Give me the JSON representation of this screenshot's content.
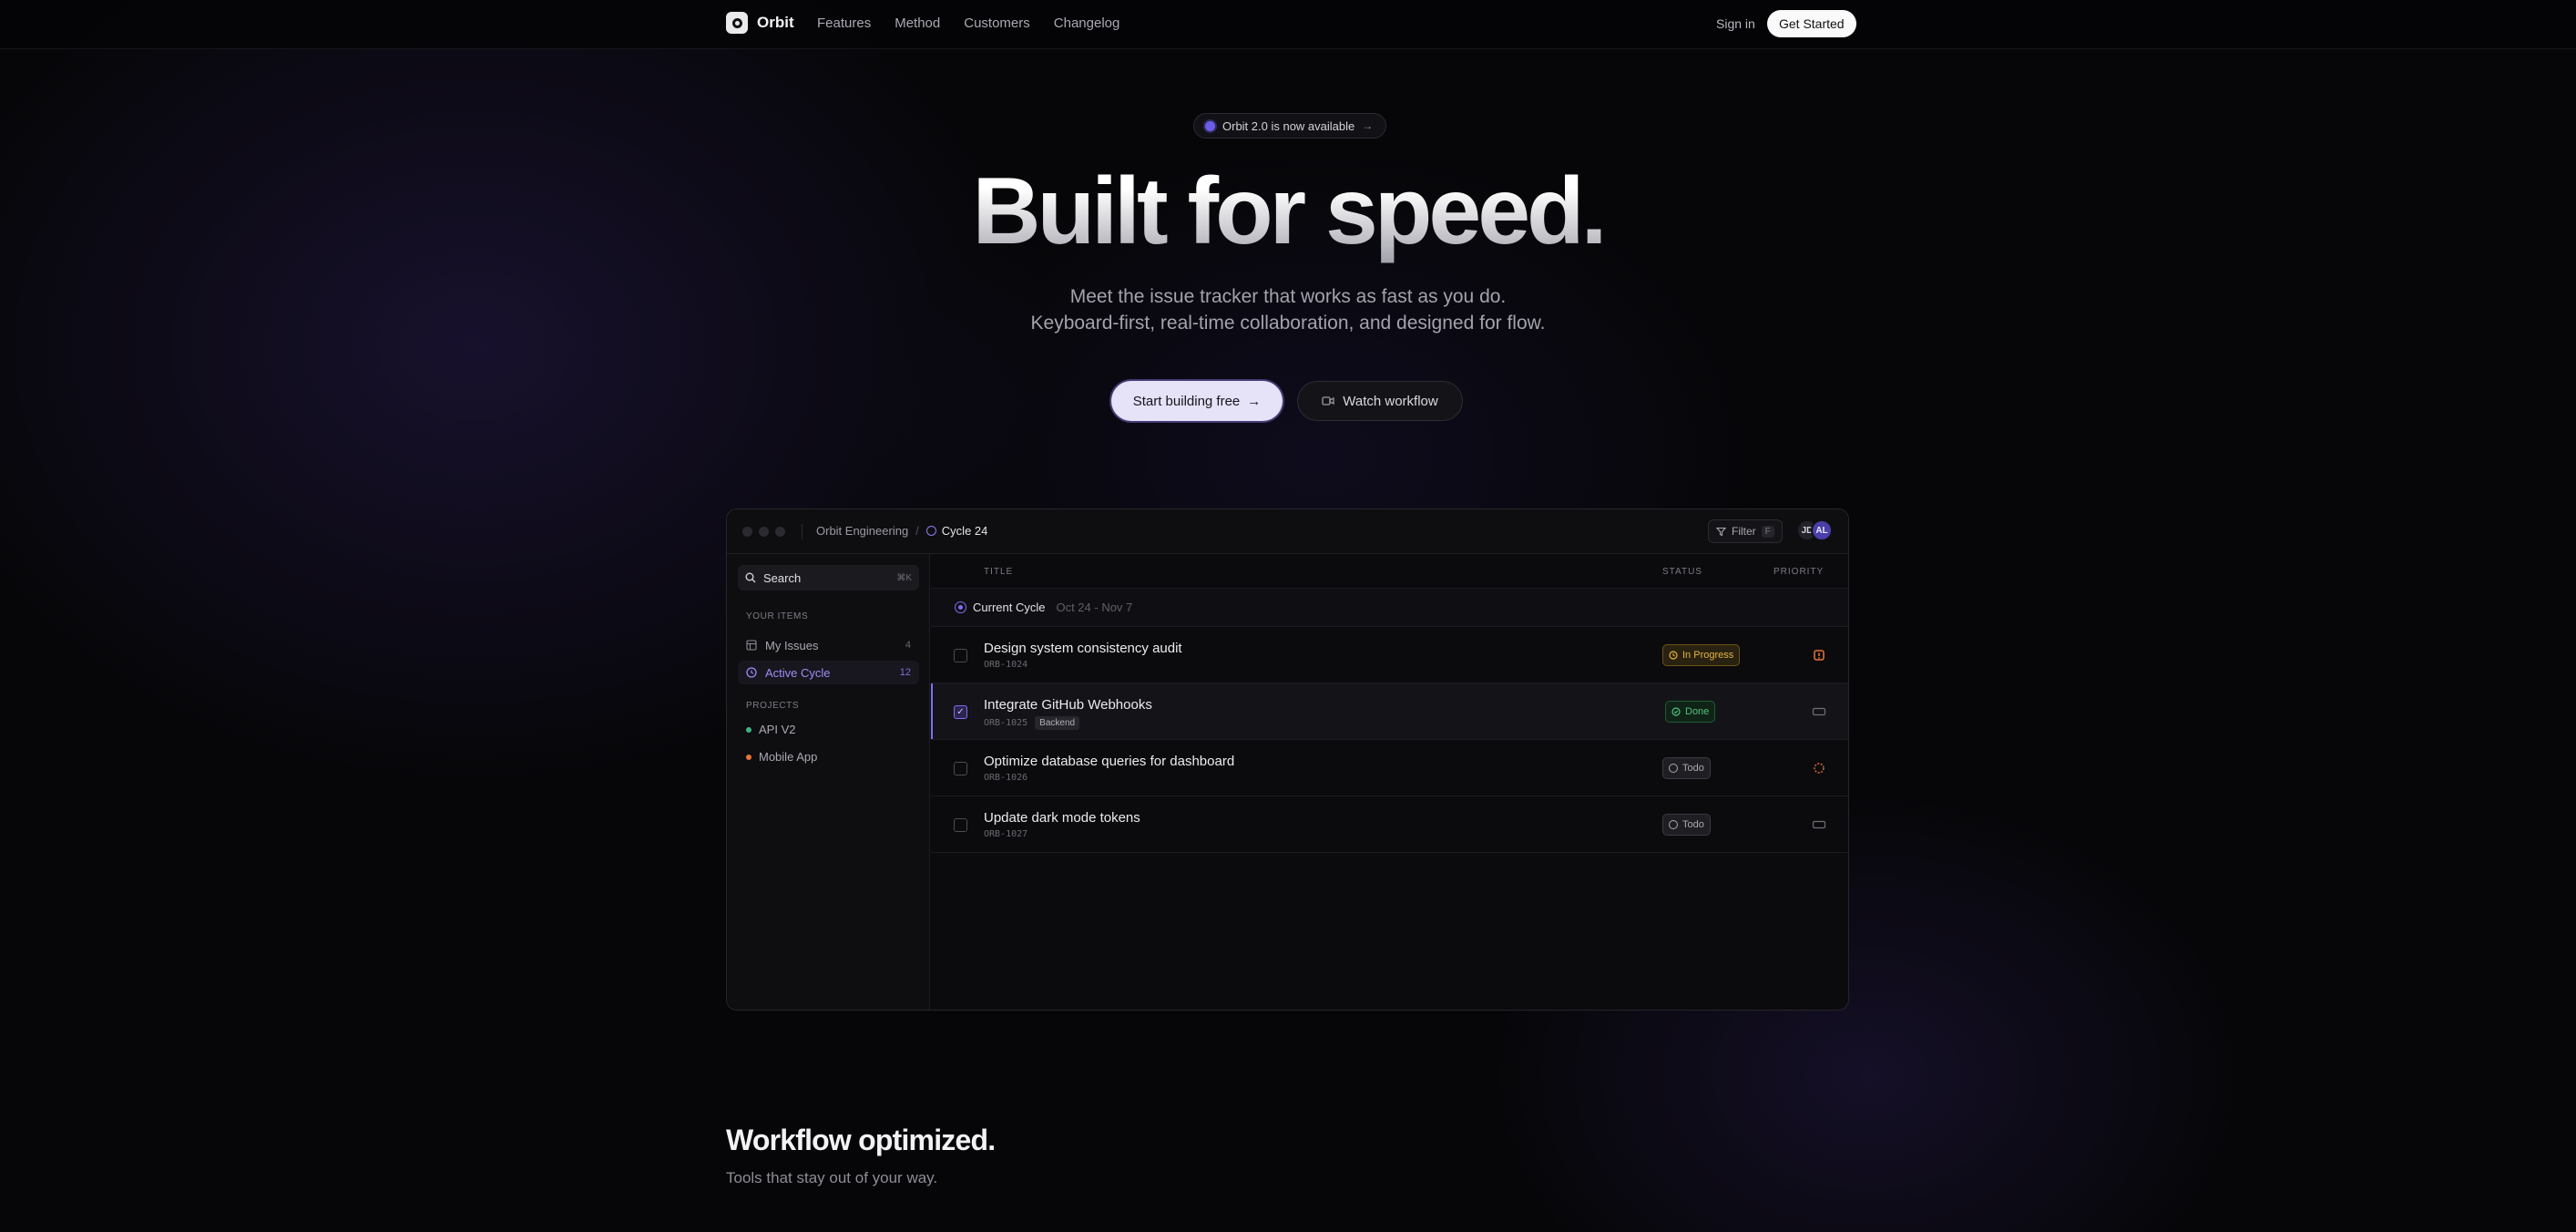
{
  "nav": {
    "brand": "Orbit",
    "links": [
      "Features",
      "Method",
      "Customers",
      "Changelog"
    ],
    "sign_in": "Sign in",
    "cta": "Get Started"
  },
  "hero": {
    "announcement": "Orbit 2.0 is now available",
    "title": "Built for speed.",
    "subtitle_line1": "Meet the issue tracker that works as fast as you do.",
    "subtitle_line2": "Keyboard-first, real-time collaboration, and designed for flow.",
    "primary_cta": "Start building free",
    "secondary_cta": "Watch workflow"
  },
  "app": {
    "breadcrumb": {
      "workspace": "Orbit Engineering",
      "separator": "/",
      "cycle": "Cycle 24"
    },
    "filter": {
      "label": "Filter",
      "shortcut": "F"
    },
    "avatars": [
      "JD",
      "AL"
    ],
    "sidebar": {
      "search": {
        "label": "Search",
        "shortcut": "⌘K"
      },
      "your_items_label": "YOUR ITEMS",
      "items": [
        {
          "label": "My Issues",
          "count": "4",
          "icon": "issues-icon"
        },
        {
          "label": "Active Cycle",
          "count": "12",
          "icon": "cycle-icon",
          "active": true
        }
      ],
      "projects_label": "PROJECTS",
      "projects": [
        {
          "label": "API V2",
          "color": "#3fb37f"
        },
        {
          "label": "Mobile App",
          "color": "#e8743b"
        }
      ]
    },
    "list": {
      "columns": {
        "title": "TITLE",
        "status": "STATUS",
        "priority": "PRIORITY"
      },
      "group": {
        "label": "Current Cycle",
        "dates": "Oct 24 - Nov 7"
      },
      "rows": [
        {
          "title": "Design system consistency audit",
          "id": "ORB-1024",
          "tag": "",
          "status": "In Progress",
          "checked": false,
          "priority": "urgent"
        },
        {
          "title": "Integrate GitHub Webhooks",
          "id": "ORB-1025",
          "tag": "Backend",
          "status": "Done",
          "checked": true,
          "priority": "none"
        },
        {
          "title": "Optimize database queries for dashboard",
          "id": "ORB-1026",
          "tag": "",
          "status": "Todo",
          "checked": false,
          "priority": "high"
        },
        {
          "title": "Update dark mode tokens",
          "id": "ORB-1027",
          "tag": "",
          "status": "Todo",
          "checked": false,
          "priority": "none"
        }
      ]
    }
  },
  "section": {
    "title": "Workflow optimized.",
    "subtitle": "Tools that stay out of your way."
  },
  "colors": {
    "accent": "#7d6ff0",
    "in_progress": "#e3b341",
    "done": "#55c07f",
    "urgent": "#e8743b"
  }
}
